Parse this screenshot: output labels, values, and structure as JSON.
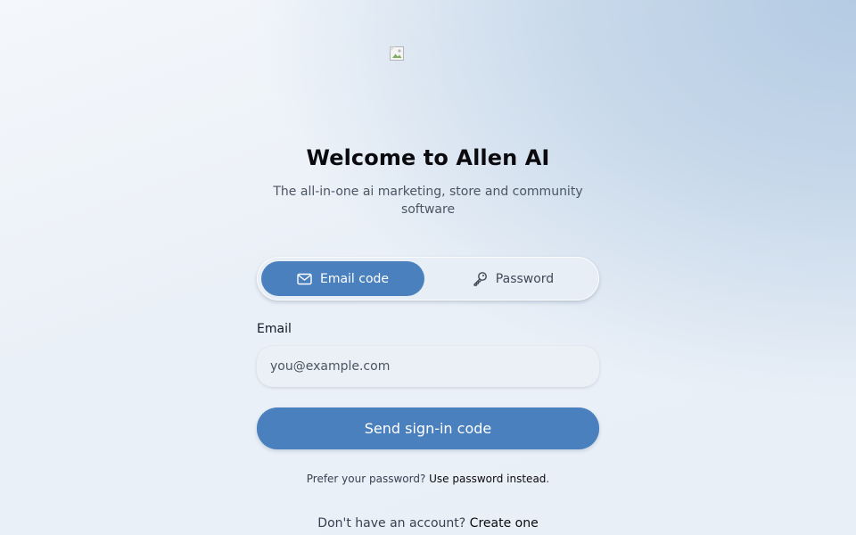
{
  "header": {
    "title": "Welcome to Allen AI",
    "subtitle": "The all-in-one ai marketing, store and community software",
    "logo_icon": "broken-image-icon"
  },
  "auth_mode_toggle": {
    "options": [
      {
        "label": "Email code",
        "icon": "mail-icon",
        "selected": true
      },
      {
        "label": "Password",
        "icon": "key-icon",
        "selected": false
      }
    ]
  },
  "form": {
    "email_label": "Email",
    "email_placeholder": "you@example.com",
    "email_value": "",
    "submit_label": "Send sign-in code"
  },
  "password_hint": {
    "prefix": "Prefer your password? ",
    "link": "Use password instead",
    "suffix": "."
  },
  "signup": {
    "prefix": "Don't have an account? ",
    "link": "Create one"
  },
  "colors": {
    "accent": "#4a80bd",
    "background_top_right": "#b4cbe3",
    "background_base": "#eef3f9",
    "toggle_track": "#e8eef6"
  }
}
